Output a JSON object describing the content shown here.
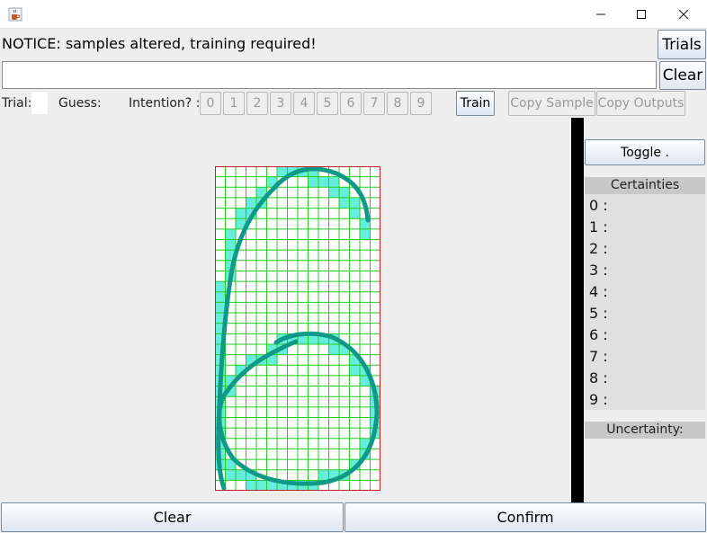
{
  "window": {
    "app_icon": "java-coffee-cup-icon",
    "controls": [
      "minimize-icon",
      "maximize-icon",
      "close-icon"
    ]
  },
  "notice": "NOTICE: samples altered, training required!",
  "top_buttons": {
    "trials": "Trials",
    "clear": "Clear"
  },
  "text_field_value": "",
  "toolbar": {
    "trial_label": "Trial:",
    "trial_value": "",
    "guess_label": "Guess:",
    "intention_label": "Intention? :",
    "digits": [
      "0",
      "1",
      "2",
      "3",
      "4",
      "5",
      "6",
      "7",
      "8",
      "9"
    ],
    "train": "Train",
    "copy_sample": "Copy Sample",
    "copy_outputs": "Copy Outputs"
  },
  "side": {
    "toggle": "Toggle .",
    "certainties_header": "Certainties",
    "certainty_rows": [
      "0 :",
      "1 :",
      "2 :",
      "3 :",
      "4 :",
      "5 :",
      "6 :",
      "7 :",
      "8 :",
      "9 :"
    ],
    "uncertainty_label": "Uncertainty:"
  },
  "bottom": {
    "clear": "Clear",
    "confirm": "Confirm"
  },
  "colors": {
    "grid_line": "#22cc22",
    "cell_fill": "#66eedd",
    "stroke": "#119988",
    "border": "#bb2222"
  }
}
